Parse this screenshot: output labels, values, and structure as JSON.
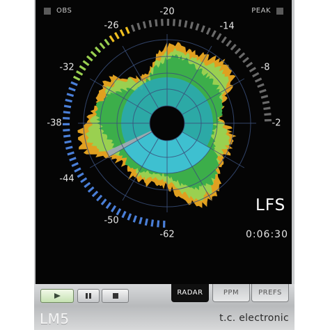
{
  "window": {
    "model": "LM5",
    "company": "t.c. electronic"
  },
  "indicators": {
    "obs": "OBS",
    "peak": "PEAK"
  },
  "scale": {
    "labels": [
      "-20",
      "-14",
      "-8",
      "-2",
      "-62",
      "-50",
      "-44",
      "-38",
      "-32",
      "-26"
    ],
    "ring": {
      "segments_total": 80,
      "blue_segments": 34,
      "green_segments": 9,
      "yellow_segments": 4,
      "gray_segments": 33
    }
  },
  "readout": {
    "unit": "LFS",
    "time": "0:06:30"
  },
  "transport": {
    "play_icon": "play-icon",
    "pause_icon": "pause-icon",
    "stop_icon": "stop-icon",
    "active": "play"
  },
  "tabs": [
    {
      "label": "RADAR",
      "active": true
    },
    {
      "label": "PPM",
      "active": false
    },
    {
      "label": "PREFS",
      "active": false
    }
  ],
  "colors": {
    "blue": "#4a7fd8",
    "yellow": "#f0c020",
    "orange": "#e0a020",
    "light_green": "#9ad050",
    "green": "#3cae4a",
    "teal": "#2aa8b0",
    "cyan": "#3ec0d0",
    "gray": "#6a6a6a"
  }
}
